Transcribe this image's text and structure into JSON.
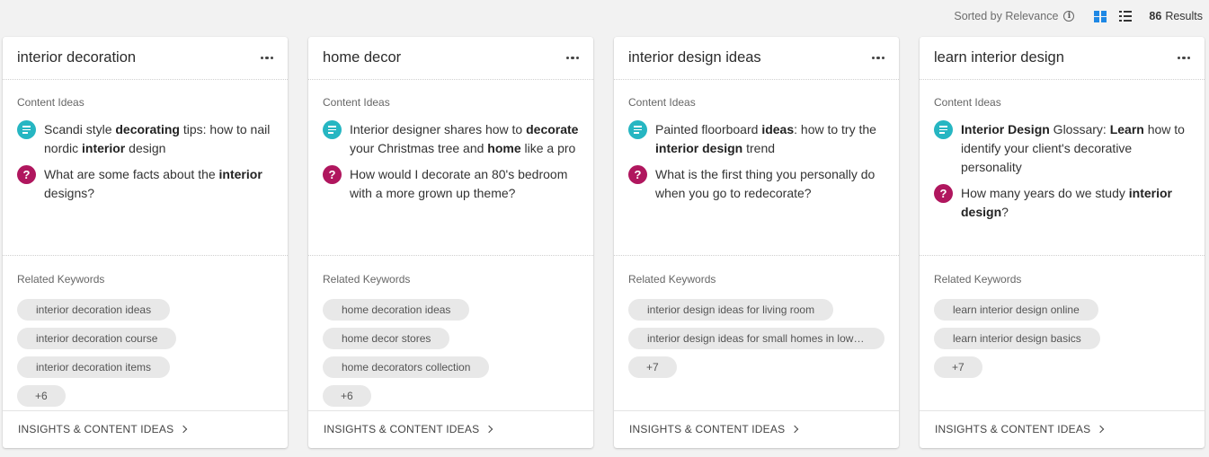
{
  "toolbar": {
    "sort_label": "Sorted by Relevance",
    "info_glyph": "i",
    "results_count": "86",
    "results_label": "Results"
  },
  "cards": [
    {
      "title": "interior decoration",
      "content_ideas_label": "Content Ideas",
      "ideas": [
        {
          "type": "article",
          "segments": [
            {
              "t": "Scandi style "
            },
            {
              "t": "decorating",
              "b": true
            },
            {
              "t": " tips: how to nail nordic "
            },
            {
              "t": "interior",
              "b": true
            },
            {
              "t": " design"
            }
          ]
        },
        {
          "type": "question",
          "segments": [
            {
              "t": "What are some facts about the "
            },
            {
              "t": "interior",
              "b": true
            },
            {
              "t": " designs?"
            }
          ]
        }
      ],
      "related_label": "Related Keywords",
      "keywords": [
        "interior decoration ideas",
        "interior decoration course",
        "interior decoration items"
      ],
      "more": "+6",
      "footer": "INSIGHTS & CONTENT IDEAS"
    },
    {
      "title": "home decor",
      "content_ideas_label": "Content Ideas",
      "ideas": [
        {
          "type": "article",
          "segments": [
            {
              "t": "Interior designer shares how to "
            },
            {
              "t": "decorate",
              "b": true
            },
            {
              "t": " your Christmas tree and "
            },
            {
              "t": "home",
              "b": true
            },
            {
              "t": " like a pro"
            }
          ]
        },
        {
          "type": "question",
          "segments": [
            {
              "t": "How would I decorate an 80's bedroom with a more grown up theme?"
            }
          ]
        }
      ],
      "related_label": "Related Keywords",
      "keywords": [
        "home decoration ideas",
        "home decor stores",
        "home decorators collection"
      ],
      "more": "+6",
      "footer": "INSIGHTS & CONTENT IDEAS"
    },
    {
      "title": "interior design ideas",
      "content_ideas_label": "Content Ideas",
      "ideas": [
        {
          "type": "article",
          "segments": [
            {
              "t": "Painted floorboard "
            },
            {
              "t": "ideas",
              "b": true
            },
            {
              "t": ": how to try the "
            },
            {
              "t": "interior design",
              "b": true
            },
            {
              "t": " trend"
            }
          ]
        },
        {
          "type": "question",
          "segments": [
            {
              "t": "What is the first thing you personally do when you go to redecorate?"
            }
          ]
        }
      ],
      "related_label": "Related Keywords",
      "keywords": [
        "interior design ideas for living room",
        "interior design ideas for small homes in low …"
      ],
      "more": "+7",
      "footer": "INSIGHTS & CONTENT IDEAS"
    },
    {
      "title": "learn interior design",
      "content_ideas_label": "Content Ideas",
      "ideas": [
        {
          "type": "article",
          "segments": [
            {
              "t": "Interior Design",
              "b": true
            },
            {
              "t": " Glossary: "
            },
            {
              "t": "Learn",
              "b": true
            },
            {
              "t": " how to identify your client's decorative personality"
            }
          ]
        },
        {
          "type": "question",
          "segments": [
            {
              "t": "How many years do we study "
            },
            {
              "t": "interior design",
              "b": true
            },
            {
              "t": "?"
            }
          ]
        }
      ],
      "related_label": "Related Keywords",
      "keywords": [
        "learn interior design online",
        "learn interior design basics"
      ],
      "more": "+7",
      "footer": "INSIGHTS & CONTENT IDEAS"
    }
  ],
  "colors": {
    "grid_view_active": "#1e88e5",
    "article_icon": "#26b6c2",
    "question_icon": "#b0165e"
  },
  "icons": {
    "article": "article-icon",
    "question": "question-icon",
    "more": "more-options-icon",
    "grid": "grid-view-icon",
    "list": "list-view-icon",
    "info": "info-icon",
    "chevron": "chevron-right-icon"
  }
}
